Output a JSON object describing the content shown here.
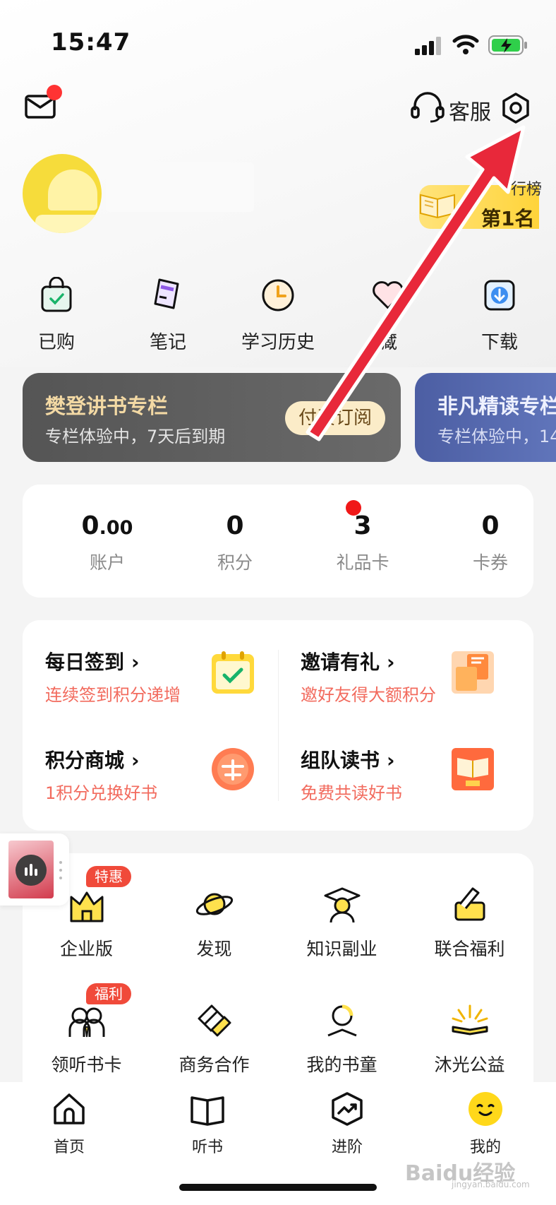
{
  "status_bar": {
    "time": "15:47"
  },
  "header": {
    "customer_service_label": "客服"
  },
  "profile": {
    "rank_small": "行榜",
    "rank_big": "第1名"
  },
  "quick_icons": [
    {
      "label": "已购",
      "icon": "shopping-bag-icon"
    },
    {
      "label": "笔记",
      "icon": "note-icon"
    },
    {
      "label": "学习历史",
      "icon": "clock-icon"
    },
    {
      "label": "藏",
      "icon": "heart-icon"
    },
    {
      "label": "下载",
      "icon": "download-icon"
    }
  ],
  "columns": [
    {
      "title": "樊登讲书专栏",
      "subtitle": "专栏体验中，7天后到期",
      "button": "付费订阅"
    },
    {
      "title": "非凡精读专栏",
      "subtitle": "专栏体验中，14"
    }
  ],
  "stats": [
    {
      "value_int": "0",
      "value_dec": ".00",
      "label": "账户"
    },
    {
      "value_int": "0",
      "value_dec": "",
      "label": "积分"
    },
    {
      "value_int": "3",
      "value_dec": "",
      "label": "礼品卡"
    },
    {
      "value_int": "0",
      "value_dec": "",
      "label": "卡券"
    }
  ],
  "tasks": [
    {
      "title": "每日签到",
      "subtitle": "连续签到积分递增"
    },
    {
      "title": "邀请有礼",
      "subtitle": "邀好友得大额积分"
    },
    {
      "title": "积分商城",
      "subtitle": "1积分兑换好书"
    },
    {
      "title": "组队读书",
      "subtitle": "免费共读好书"
    }
  ],
  "task_chevron": "›",
  "grid": [
    {
      "label": "企业版",
      "icon": "enterprise-icon",
      "tag": "特惠"
    },
    {
      "label": "发现",
      "icon": "planet-icon"
    },
    {
      "label": "知识副业",
      "icon": "graduate-icon"
    },
    {
      "label": "联合福利",
      "icon": "gift-pen-icon"
    },
    {
      "label": "领听书卡",
      "icon": "card-people-icon",
      "tag": "福利"
    },
    {
      "label": "商务合作",
      "icon": "handshake-icon"
    },
    {
      "label": "我的书童",
      "icon": "book-boy-icon"
    },
    {
      "label": "沐光公益",
      "icon": "sunrise-book-icon"
    }
  ],
  "tabs": [
    {
      "label": "首页",
      "icon": "home-icon"
    },
    {
      "label": "听书",
      "icon": "book-icon"
    },
    {
      "label": "进阶",
      "icon": "trend-icon"
    },
    {
      "label": "我的",
      "icon": "smile-icon"
    }
  ],
  "watermark": {
    "main": "Baidu经验",
    "sub": "jingyan.baidu.com"
  },
  "colors": {
    "accent_red": "#f04a3a",
    "arrow_red": "#e8283a",
    "avatar_yellow": "#f6dc3b"
  }
}
